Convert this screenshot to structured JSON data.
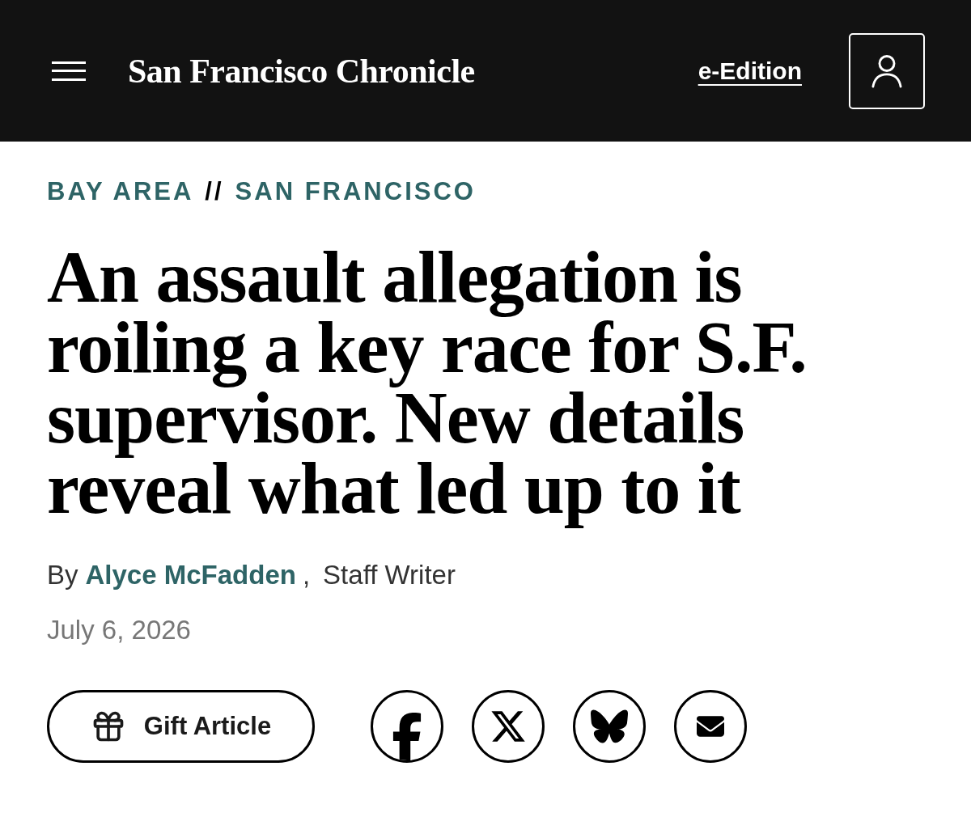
{
  "header": {
    "logo": "San Francisco Chronicle",
    "edition_link": "e-Edition"
  },
  "kicker": {
    "section": "BAY AREA",
    "separator": "//",
    "subsection": "SAN FRANCISCO"
  },
  "headline": "An assault allegation is roiling a key race for S.F. supervisor. New details reveal what led up to it",
  "byline": {
    "prefix": "By",
    "author": "Alyce McFadden",
    "separator": ",",
    "role": "Staff Writer"
  },
  "date": "July 6, 2026",
  "actions": {
    "gift_button": "Gift Article",
    "share": [
      {
        "kind": "facebook"
      },
      {
        "kind": "x"
      },
      {
        "kind": "bluesky"
      },
      {
        "kind": "email"
      }
    ]
  }
}
